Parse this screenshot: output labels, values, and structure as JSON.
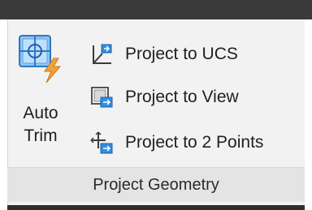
{
  "big_button": {
    "label_line1": "Auto",
    "label_line2": "Trim",
    "icon": "auto-trim-icon"
  },
  "commands": [
    {
      "label": "Project to UCS",
      "icon": "project-to-ucs-icon"
    },
    {
      "label": "Project to View",
      "icon": "project-to-view-icon"
    },
    {
      "label": "Project to 2 Points",
      "icon": "project-to-2-points-icon"
    }
  ],
  "panel": {
    "title": "Project Geometry"
  },
  "colors": {
    "accent_blue": "#2f8ee0",
    "lightning_orange": "#f2a23a",
    "top_bar": "#3a3a3a",
    "panel_bg": "#f2f2f2"
  }
}
